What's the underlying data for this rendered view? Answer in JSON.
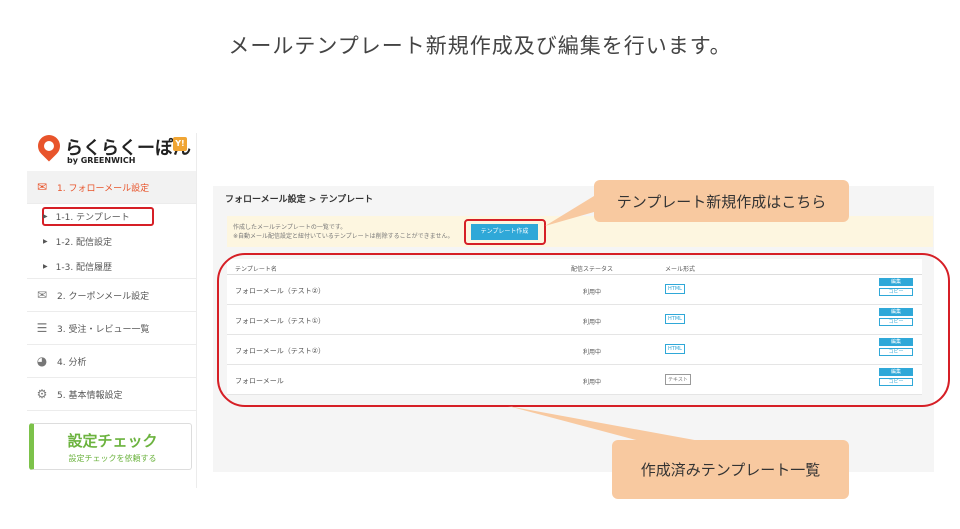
{
  "heading": "メールテンプレート新規作成及び編集を行います。",
  "logo": {
    "text": "らくらくーぽん",
    "sub": "by GREENWICH",
    "badge": "Y!"
  },
  "sidebar": {
    "sections": [
      {
        "label": "1. フォローメール設定",
        "icon": "mail-icon"
      },
      {
        "label": "2. クーポンメール設定",
        "icon": "open-mail-icon"
      },
      {
        "label": "3. 受注・レビュー一覧",
        "icon": "list-icon"
      },
      {
        "label": "4. 分析",
        "icon": "pie-chart-icon"
      },
      {
        "label": "5. 基本情報設定",
        "icon": "gear-icon"
      }
    ],
    "subitems": [
      {
        "label": "1-1. テンプレート"
      },
      {
        "label": "1-2. 配信設定"
      },
      {
        "label": "1-3. 配信履歴"
      }
    ],
    "check": {
      "title": "設定チェック",
      "sub": "設定チェックを依頼する"
    }
  },
  "main": {
    "breadcrumb": "フォローメール設定 > テンプレート",
    "notice_line1": "作成したメールテンプレートの一覧です。",
    "notice_line2": "※自動メール配信設定と紐付いているテンプレートは削除することができません。",
    "new_button": "テンプレート作成",
    "columns": {
      "name": "テンプレート名",
      "status": "配信ステータス",
      "format": "メール形式"
    },
    "rows": [
      {
        "name": "フォローメール（テスト②）",
        "status": "利用中",
        "format": "HTML",
        "edit": "編集",
        "copy": "コピー"
      },
      {
        "name": "フォローメール（テスト①）",
        "status": "利用中",
        "format": "HTML",
        "edit": "編集",
        "copy": "コピー"
      },
      {
        "name": "フォローメール（テスト②）",
        "status": "利用中",
        "format": "HTML",
        "edit": "編集",
        "copy": "コピー"
      },
      {
        "name": "フォローメール",
        "status": "利用中",
        "format": "テキスト",
        "edit": "編集",
        "copy": "コピー"
      }
    ]
  },
  "callouts": {
    "new": "テンプレート新規作成はこちら",
    "list": "作成済みテンプレート一覧"
  },
  "colors": {
    "accent": "#e8542b",
    "highlight": "#d61f26",
    "button": "#2fa8d8",
    "callout": "#f8c9a0",
    "check": "#6cb33f"
  }
}
